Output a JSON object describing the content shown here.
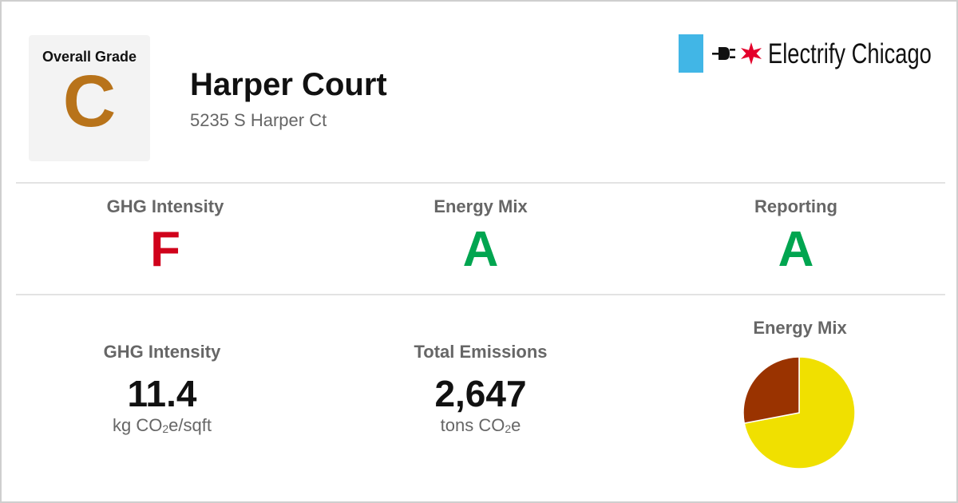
{
  "overall": {
    "label": "Overall Grade",
    "grade": "C",
    "grade_color": "#b8731a"
  },
  "building": {
    "name": "Harper Court",
    "address": "5235 S Harper Ct"
  },
  "brand": {
    "name": "Electrify Chicago",
    "swatch_color": "#41b6e6",
    "star_color": "#e4002b",
    "icons": [
      "plug-icon",
      "star-icon"
    ]
  },
  "grades": [
    {
      "label": "GHG Intensity",
      "grade": "F",
      "color": "#d0021b"
    },
    {
      "label": "Energy Mix",
      "grade": "A",
      "color": "#00a550"
    },
    {
      "label": "Reporting",
      "grade": "A",
      "color": "#00a550"
    }
  ],
  "metrics": {
    "ghg": {
      "label": "GHG Intensity",
      "value": "11.4",
      "unit_prefix": "kg CO",
      "unit_sub": "2",
      "unit_suffix": "e/sqft"
    },
    "emissions": {
      "label": "Total Emissions",
      "value": "2,647",
      "unit_prefix": "tons CO",
      "unit_sub": "2",
      "unit_suffix": "e"
    }
  },
  "energy_mix": {
    "title": "Energy Mix"
  },
  "chart_data": {
    "type": "pie",
    "title": "Energy Mix",
    "slices": [
      {
        "value": 0.72,
        "color": "#f0e000"
      },
      {
        "value": 0.28,
        "color": "#9a3300"
      }
    ]
  }
}
